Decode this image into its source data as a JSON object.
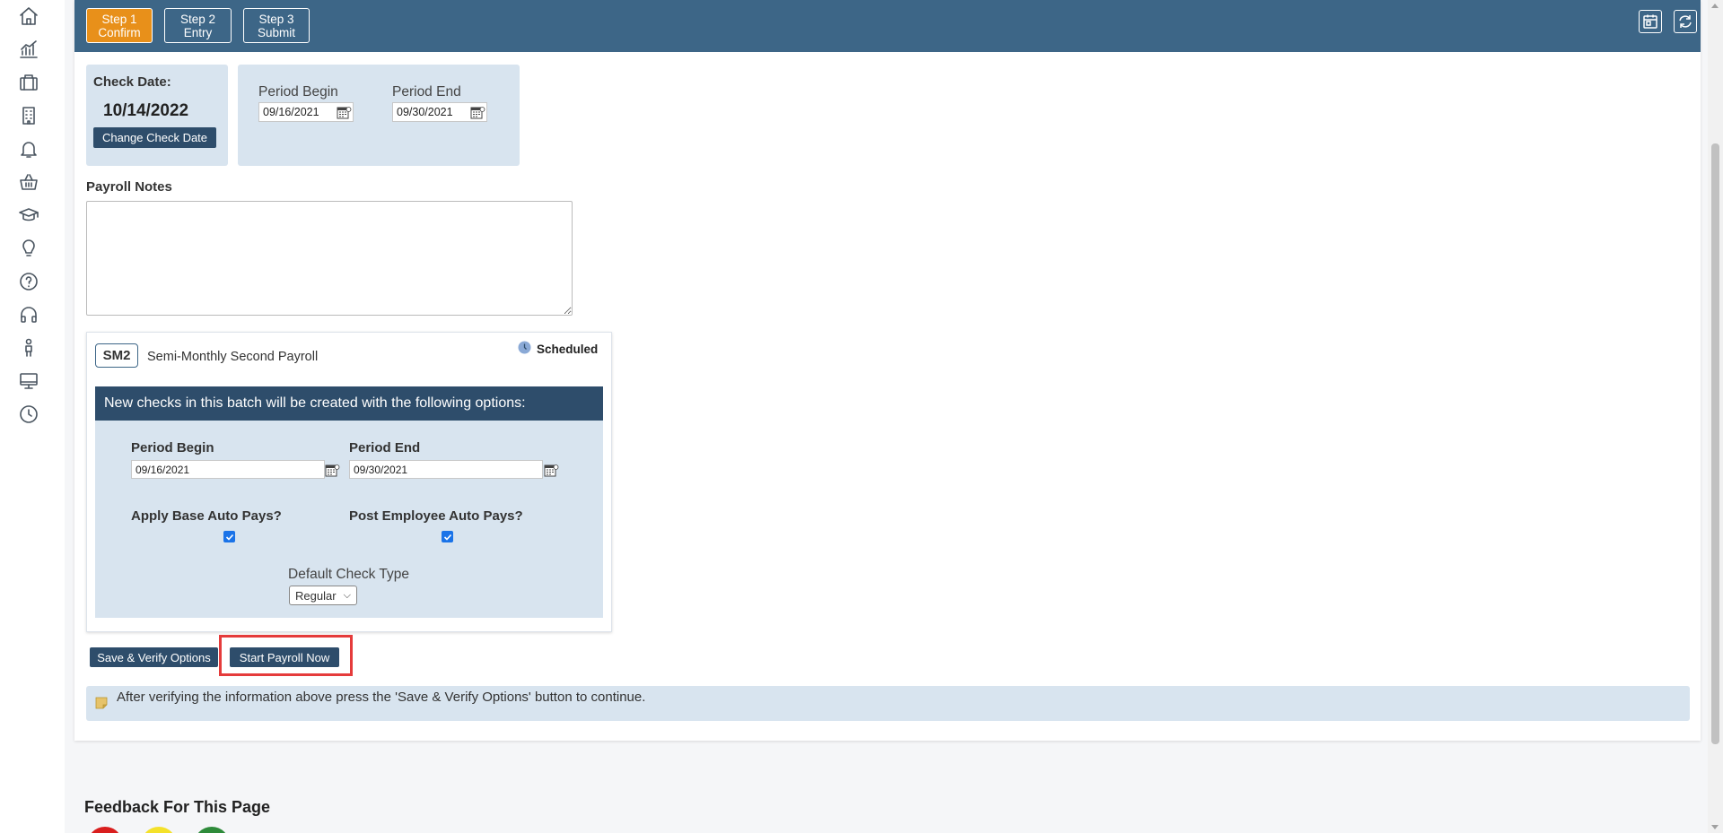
{
  "sidebar": {
    "icons": [
      {
        "name": "home-icon"
      },
      {
        "name": "chart-icon"
      },
      {
        "name": "briefcase-icon"
      },
      {
        "name": "building-icon"
      },
      {
        "name": "bell-icon"
      },
      {
        "name": "basket-icon"
      },
      {
        "name": "graduation-cap-icon"
      },
      {
        "name": "lightbulb-icon"
      },
      {
        "name": "help-icon"
      },
      {
        "name": "headset-icon"
      },
      {
        "name": "person-icon"
      },
      {
        "name": "monitor-icon"
      },
      {
        "name": "clock-icon"
      }
    ]
  },
  "header": {
    "steps": [
      {
        "line1": "Step 1",
        "line2": "Confirm",
        "active": true
      },
      {
        "line1": "Step 2",
        "line2": "Entry",
        "active": false
      },
      {
        "line1": "Step 3",
        "line2": "Submit",
        "active": false
      }
    ],
    "icons": [
      "calendar-icon",
      "refresh-icon"
    ]
  },
  "check_date": {
    "label": "Check Date:",
    "value": "10/14/2022",
    "button": "Change Check Date"
  },
  "period": {
    "begin_label": "Period Begin",
    "begin_value": "09/16/2021",
    "end_label": "Period End",
    "end_value": "09/30/2021"
  },
  "payroll_notes": {
    "label": "Payroll Notes",
    "value": ""
  },
  "payroll": {
    "code": "SM2",
    "name": "Semi-Monthly Second Payroll",
    "status": "Scheduled",
    "options_header": "New checks in this batch will be created with the following options:",
    "period_begin_label": "Period Begin",
    "period_begin_value": "09/16/2021",
    "period_end_label": "Period End",
    "period_end_value": "09/30/2021",
    "apply_base_label": "Apply Base Auto Pays?",
    "apply_base_checked": true,
    "post_employee_label": "Post Employee Auto Pays?",
    "post_employee_checked": true,
    "check_type_label": "Default Check Type",
    "check_type_value": "Regular"
  },
  "actions": {
    "save_verify": "Save & Verify Options",
    "start_payroll": "Start Payroll Now"
  },
  "info": {
    "message": "After verifying the information above press the 'Save & Verify Options' button to continue."
  },
  "feedback": {
    "title": "Feedback For This Page"
  },
  "colors": {
    "header": "#3d6687",
    "active_step": "#e8901a",
    "card": "#d8e4ef",
    "dark_button": "#2e4d6b",
    "highlight": "#e53b3b"
  }
}
